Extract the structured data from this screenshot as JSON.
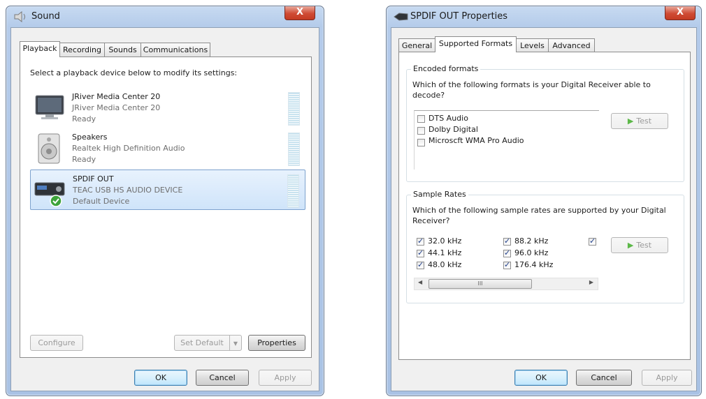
{
  "sound_dialog": {
    "title": "Sound",
    "close": "X",
    "tabs": [
      "Playback",
      "Recording",
      "Sounds",
      "Communications"
    ],
    "instruction": "Select a playback device below to modify its settings:",
    "devices": [
      {
        "name": "JRiver Media Center 20",
        "description": "JRiver Media Center 20",
        "status": "Ready",
        "icon": "monitor-icon"
      },
      {
        "name": "Speakers",
        "description": "Realtek High Definition Audio",
        "status": "Ready",
        "icon": "speaker-icon"
      },
      {
        "name": "SPDIF OUT",
        "description": "TEAC USB HS AUDIO DEVICE",
        "status": "Default Device",
        "icon": "audio-device-icon",
        "selected": true
      }
    ],
    "buttons": {
      "configure": "Configure",
      "set_default": "Set Default",
      "properties": "Properties",
      "ok": "OK",
      "cancel": "Cancel",
      "apply": "Apply"
    }
  },
  "properties_dialog": {
    "title": "SPDIF OUT Properties",
    "close": "X",
    "tabs": [
      "General",
      "Supported Formats",
      "Levels",
      "Advanced"
    ],
    "encoded_formats": {
      "label": "Encoded formats",
      "question": "Which of the following formats is your Digital Receiver able to decode?",
      "formats": [
        {
          "name": "DTS Audio",
          "checked": false
        },
        {
          "name": "Dolby Digital",
          "checked": false
        },
        {
          "name": "Microscft WMA Pro Audio",
          "checked": false
        }
      ],
      "test": "Test"
    },
    "sample_rates": {
      "label": "Sample Rates",
      "question": "Which of the following sample rates are supported by your Digital Receiver?",
      "rates_col1": [
        "32.0 kHz",
        "44.1 kHz",
        "48.0 kHz"
      ],
      "rates_col2": [
        "88.2 kHz",
        "96.0 kHz",
        "176.4 kHz"
      ],
      "scroll_thumb": "III",
      "test": "Test"
    },
    "buttons": {
      "ok": "OK",
      "cancel": "Cancel",
      "apply": "Apply"
    }
  }
}
